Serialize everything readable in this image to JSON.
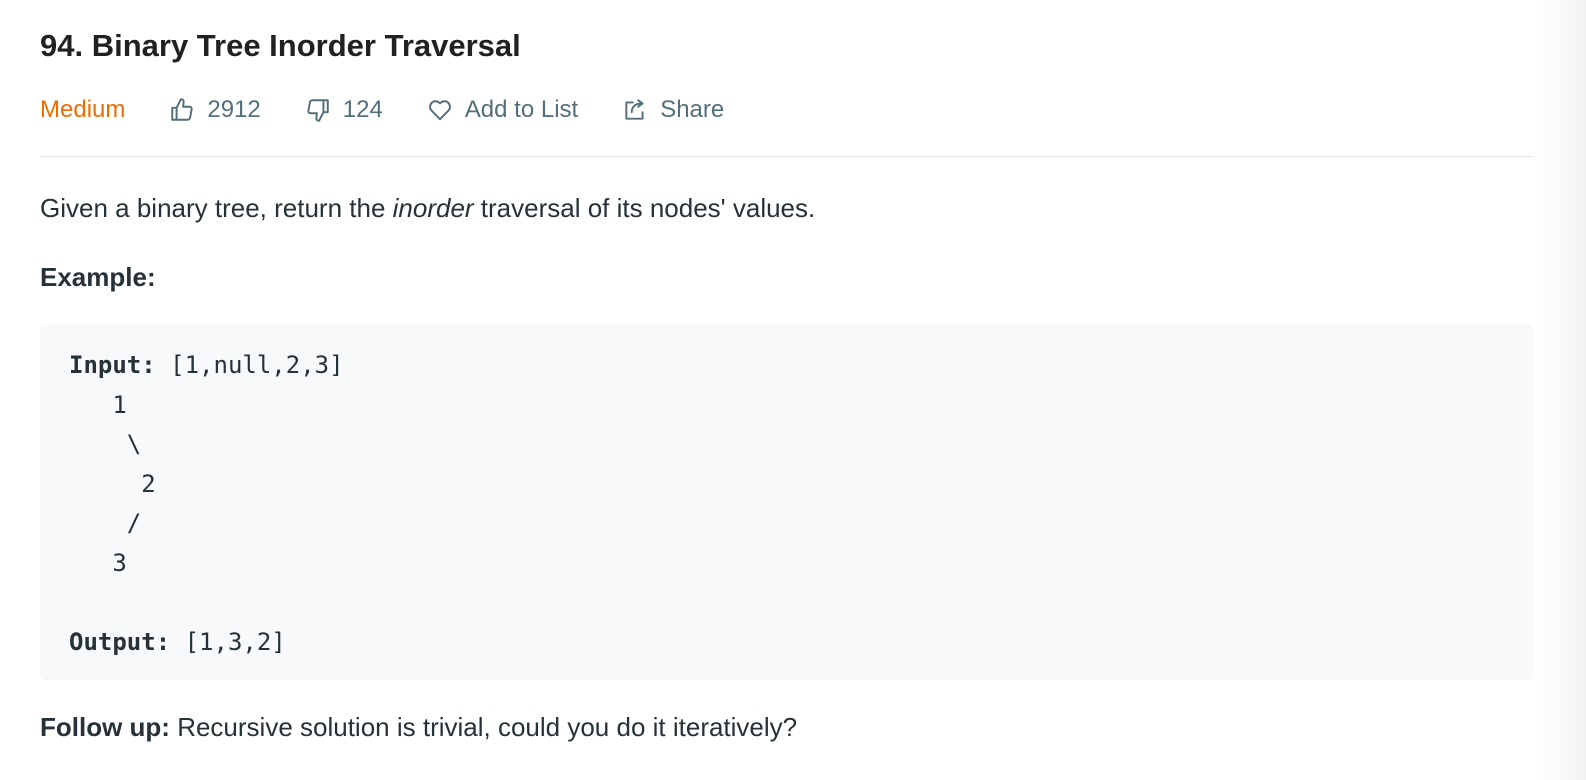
{
  "problem": {
    "title": "94. Binary Tree Inorder Traversal",
    "difficulty": "Medium",
    "likes": "2912",
    "dislikes": "124",
    "add_to_list_label": "Add to List",
    "share_label": "Share"
  },
  "description": {
    "before": "Given a binary tree, return the ",
    "emphasis": "inorder",
    "after": " traversal of its nodes' values."
  },
  "example": {
    "heading": "Example:",
    "input_label": "Input:",
    "input_value": " [1,null,2,3]",
    "tree_lines": "   1\n    \\\n     2\n    /\n   3\n",
    "output_label": "Output:",
    "output_value": " [1,3,2]"
  },
  "follow_up": {
    "label": "Follow up:",
    "text": " Recursive solution is trivial, could you do it iteratively?"
  },
  "colors": {
    "difficulty_medium": "#ef6c00",
    "meta_text": "#546e7a",
    "code_background": "#f7f9fa"
  },
  "icons": {
    "like": "thumbs-up-icon",
    "dislike": "thumbs-down-icon",
    "add_to_list": "heart-icon",
    "share": "share-icon"
  }
}
